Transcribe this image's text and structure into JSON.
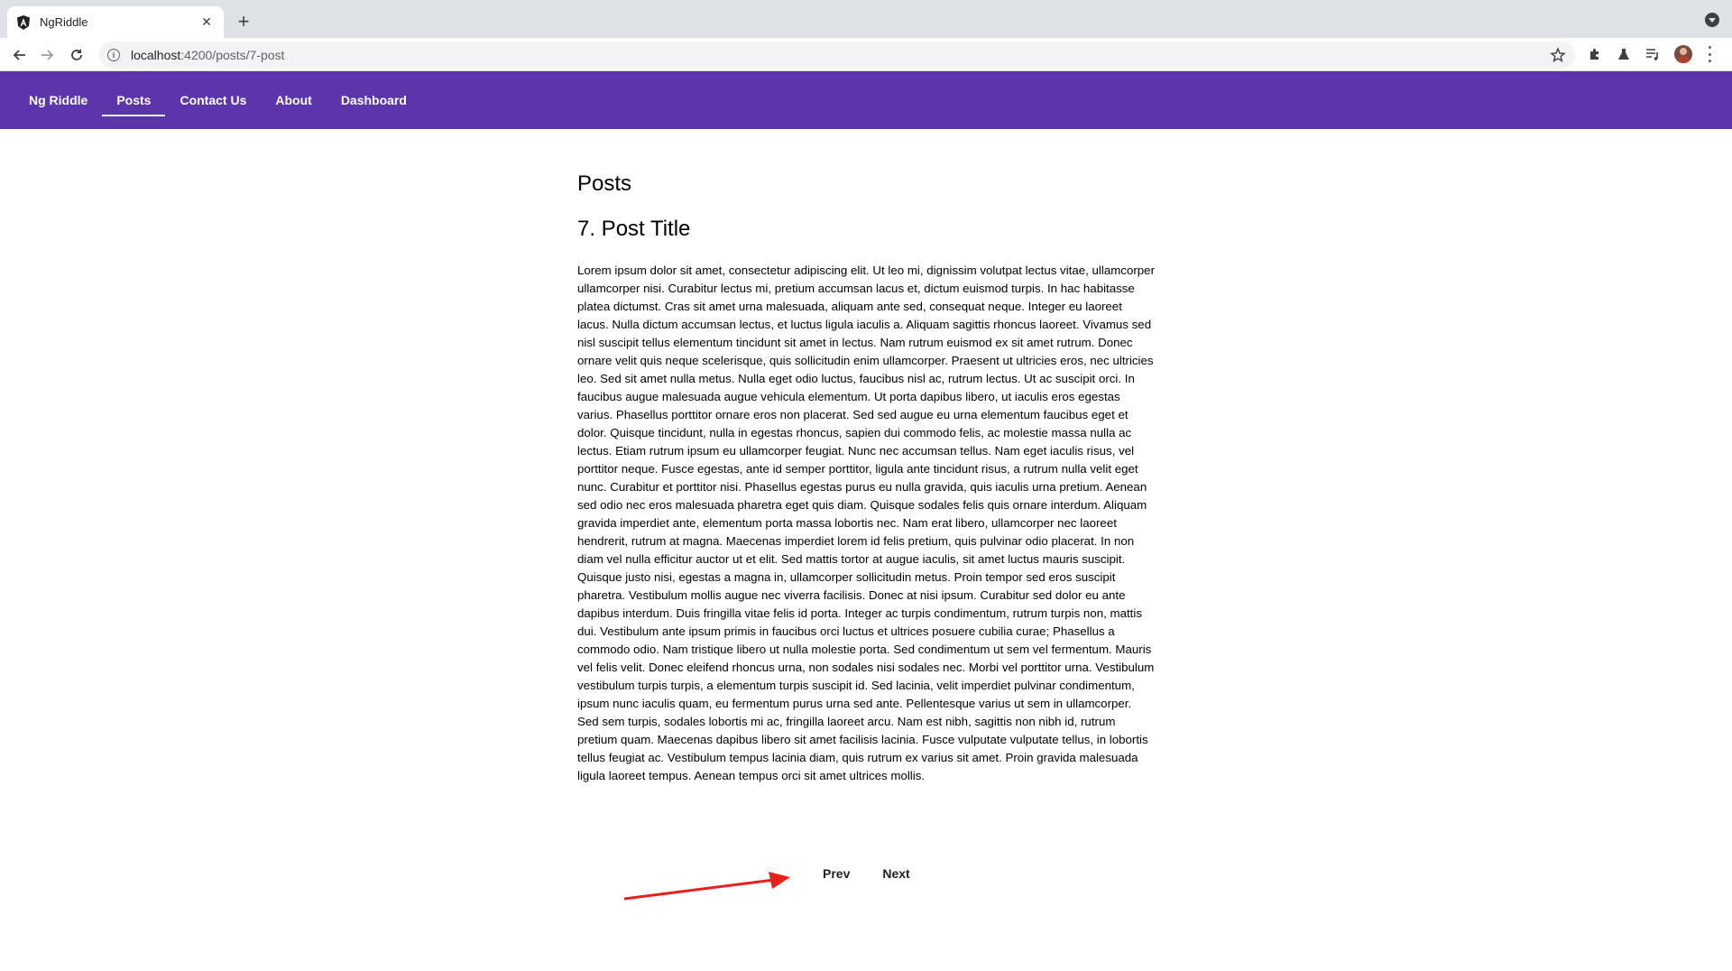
{
  "browser": {
    "tab_title": "NgRiddle",
    "url_host": "localhost",
    "url_path": ":4200/posts/7-post"
  },
  "nav": {
    "brand": "Ng Riddle",
    "items": [
      {
        "label": "Posts",
        "active": true
      },
      {
        "label": "Contact Us",
        "active": false
      },
      {
        "label": "About",
        "active": false
      },
      {
        "label": "Dashboard",
        "active": false
      }
    ]
  },
  "page": {
    "title": "Posts",
    "post_title": "7. Post Title",
    "post_body": "Lorem ipsum dolor sit amet, consectetur adipiscing elit. Ut leo mi, dignissim volutpat lectus vitae, ullamcorper ullamcorper nisi. Curabitur lectus mi, pretium accumsan lacus et, dictum euismod turpis. In hac habitasse platea dictumst. Cras sit amet urna malesuada, aliquam ante sed, consequat neque. Integer eu laoreet lacus. Nulla dictum accumsan lectus, et luctus ligula iaculis a. Aliquam sagittis rhoncus laoreet. Vivamus sed nisl suscipit tellus elementum tincidunt sit amet in lectus. Nam rutrum euismod ex sit amet rutrum. Donec ornare velit quis neque scelerisque, quis sollicitudin enim ullamcorper. Praesent ut ultricies eros, nec ultricies leo. Sed sit amet nulla metus. Nulla eget odio luctus, faucibus nisl ac, rutrum lectus. Ut ac suscipit orci. In faucibus augue malesuada augue vehicula elementum. Ut porta dapibus libero, ut iaculis eros egestas varius. Phasellus porttitor ornare eros non placerat. Sed sed augue eu urna elementum faucibus eget et dolor. Quisque tincidunt, nulla in egestas rhoncus, sapien dui commodo felis, ac molestie massa nulla ac lectus. Etiam rutrum ipsum eu ullamcorper feugiat. Nunc nec accumsan tellus. Nam eget iaculis risus, vel porttitor neque. Fusce egestas, ante id semper porttitor, ligula ante tincidunt risus, a rutrum nulla velit eget nunc. Curabitur et porttitor nisi. Phasellus egestas purus eu nulla gravida, quis iaculis urna pretium. Aenean sed odio nec eros malesuada pharetra eget quis diam. Quisque sodales felis quis ornare interdum. Aliquam gravida imperdiet ante, elementum porta massa lobortis nec. Nam erat libero, ullamcorper nec laoreet hendrerit, rutrum at magna. Maecenas imperdiet lorem id felis pretium, quis pulvinar odio placerat. In non diam vel nulla efficitur auctor ut et elit. Sed mattis tortor at augue iaculis, sit amet luctus mauris suscipit. Quisque justo nisi, egestas a magna in, ullamcorper sollicitudin metus. Proin tempor sed eros suscipit pharetra. Vestibulum mollis augue nec viverra facilisis. Donec at nisi ipsum. Curabitur sed dolor eu ante dapibus interdum. Duis fringilla vitae felis id porta. Integer ac turpis condimentum, rutrum turpis non, mattis dui. Vestibulum ante ipsum primis in faucibus orci luctus et ultrices posuere cubilia curae; Phasellus a commodo odio. Nam tristique libero ut nulla molestie porta. Sed condimentum ut sem vel fermentum. Mauris vel felis velit. Donec eleifend rhoncus urna, non sodales nisi sodales nec. Morbi vel porttitor urna. Vestibulum vestibulum turpis turpis, a elementum turpis suscipit id. Sed lacinia, velit imperdiet pulvinar condimentum, ipsum nunc iaculis quam, eu fermentum purus urna sed ante. Pellentesque varius ut sem in ullamcorper. Sed sem turpis, sodales lobortis mi ac, fringilla laoreet arcu. Nam est nibh, sagittis non nibh id, rutrum pretium quam. Maecenas dapibus libero sit amet facilisis lacinia. Fusce vulputate vulputate tellus, in lobortis tellus feugiat ac. Vestibulum tempus lacinia diam, quis rutrum ex varius sit amet. Proin gravida malesuada ligula laoreet tempus. Aenean tempus orci sit amet ultrices mollis."
  },
  "pager": {
    "prev_label": "Prev",
    "next_label": "Next"
  },
  "colors": {
    "nav_background": "#5c35ad",
    "annotation_arrow": "#e8201c"
  },
  "icons": [
    "angular-favicon-icon",
    "close-icon",
    "plus-icon",
    "back-arrow-icon",
    "forward-arrow-icon",
    "reload-icon",
    "info-icon",
    "star-icon",
    "puzzle-icon",
    "flask-icon",
    "playlist-icon",
    "avatar",
    "kebab-menu-icon",
    "tab-search-icon"
  ]
}
